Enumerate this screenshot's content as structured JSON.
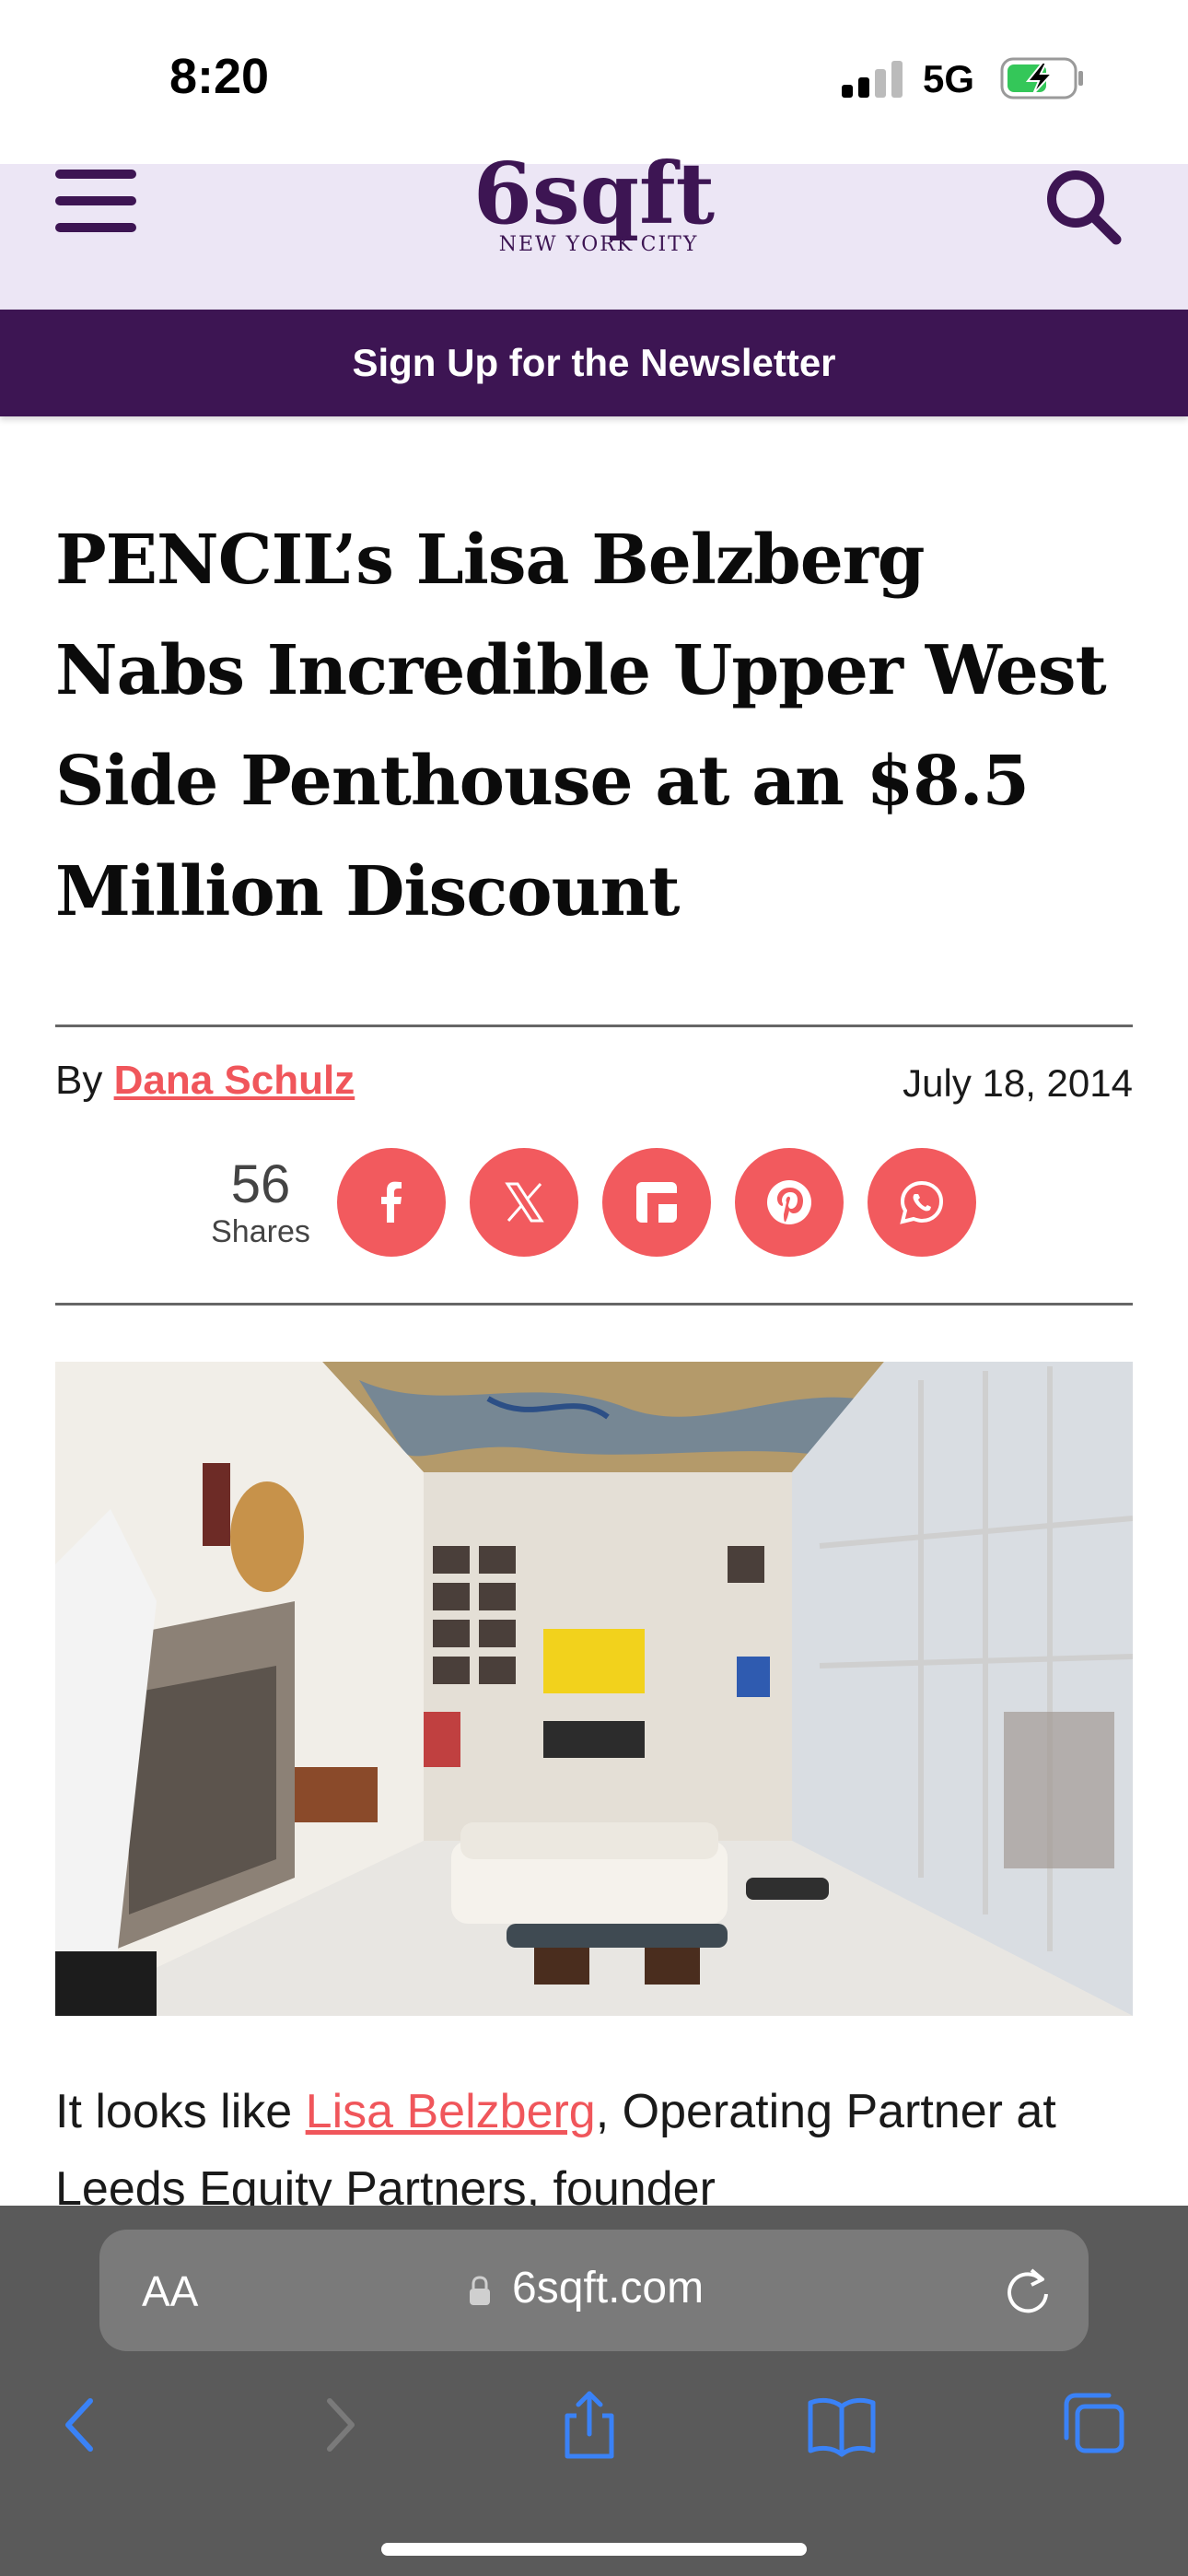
{
  "status_bar": {
    "time": "8:20",
    "network": "5G"
  },
  "site": {
    "logo_main": "6sqft",
    "logo_sub_left": "NEW YORK",
    "logo_sub_right": "CITY",
    "newsletter_label": "Sign Up for the Newsletter"
  },
  "article": {
    "headline": "PENCIL’s Lisa Belzberg Nabs Incredible Upper West Side Penthouse at an $8.5 Million Discount",
    "byline_prefix": "By",
    "author": "Dana Schulz",
    "date": "July 18, 2014",
    "share_count": "56",
    "share_label": "Shares",
    "body_before_link": "It looks like ",
    "body_link": "Lisa Belzberg",
    "body_after_link": ", Operating Partner at Leeds Equity Partners, founder"
  },
  "social_buttons": [
    {
      "icon": "facebook-icon"
    },
    {
      "icon": "x-icon"
    },
    {
      "icon": "flipboard-icon"
    },
    {
      "icon": "pinterest-icon"
    },
    {
      "icon": "whatsapp-icon"
    }
  ],
  "browser": {
    "aa_label": "AA",
    "url": "6sqft.com"
  },
  "colors": {
    "brand_purple": "#3d1553",
    "header_bg": "#ece6f5",
    "accent_coral": "#f25a5e",
    "safari_bg": "#5a5a5a",
    "ios_blue": "#3a82f7"
  }
}
